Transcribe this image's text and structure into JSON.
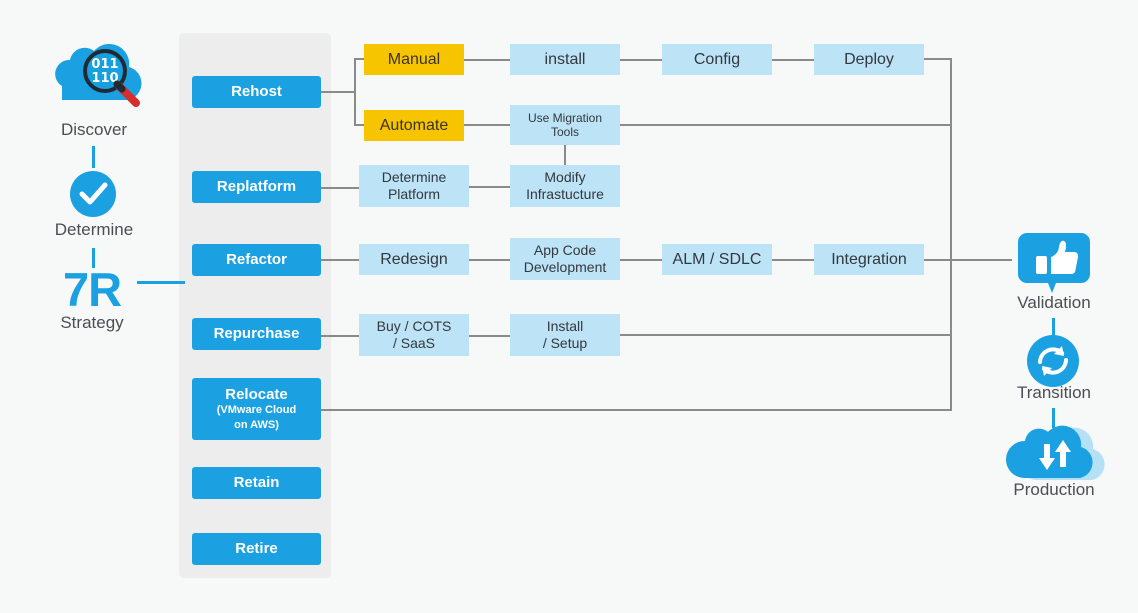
{
  "diagram": {
    "title": "7R Cloud Migration Strategy Flow",
    "colors": {
      "accent_blue": "#1ba1e2",
      "light_blue": "#bde3f7",
      "yellow": "#f6c500",
      "panel_gray": "#ededed",
      "line_gray": "#8a8a8a",
      "background": "#f7f8f8",
      "text_dark": "#4a4f54"
    }
  },
  "left_stages": [
    {
      "label": "Discover",
      "icon": "cloud-magnifier-binary-icon"
    },
    {
      "label": "Determine",
      "icon": "check-circle-icon"
    }
  ],
  "strategy_heading": {
    "title": "7R",
    "subtitle": "Strategy"
  },
  "strategies": [
    {
      "label": "Rehost",
      "sub": ""
    },
    {
      "label": "Replatform",
      "sub": ""
    },
    {
      "label": "Refactor",
      "sub": ""
    },
    {
      "label": "Repurchase",
      "sub": ""
    },
    {
      "label": "Relocate",
      "sub": "(VMware Cloud\non AWS)"
    },
    {
      "label": "Retain",
      "sub": ""
    },
    {
      "label": "Retire",
      "sub": ""
    }
  ],
  "rows": {
    "rehost_manual": [
      "Manual",
      "install",
      "Config",
      "Deploy"
    ],
    "rehost_automate": [
      "Automate",
      "Use Migration Tools"
    ],
    "replatform": [
      "Determine Platform",
      "Modify Infrastucture"
    ],
    "refactor": [
      "Redesign",
      "App Code Development",
      "ALM / SDLC",
      "Integration"
    ],
    "repurchase": [
      "Buy / COTS / SaaS",
      "Install / Setup"
    ]
  },
  "boxes": {
    "manual": "Manual",
    "install": "install",
    "config": "Config",
    "deploy": "Deploy",
    "automate": "Automate",
    "use_migration_tools_l1": "Use Migration",
    "use_migration_tools_l2": "Tools",
    "determine_platform_l1": "Determine",
    "determine_platform_l2": "Platform",
    "modify_infra_l1": "Modify",
    "modify_infra_l2": "Infrastucture",
    "redesign": "Redesign",
    "app_code_l1": "App Code",
    "app_code_l2": "Development",
    "alm_sdlc": "ALM / SDLC",
    "integration": "Integration",
    "buy_cots_l1": "Buy / COTS",
    "buy_cots_l2": "/ SaaS",
    "install_setup_l1": "Install",
    "install_setup_l2": "/ Setup",
    "relocate_main": "Relocate",
    "relocate_sub_l1": "(VMware Cloud",
    "relocate_sub_l2": "on AWS)",
    "rehost": "Rehost",
    "replatform": "Replatform",
    "refactor": "Refactor",
    "repurchase": "Repurchase",
    "retain": "Retain",
    "retire": "Retire"
  },
  "right_stages": [
    {
      "label": "Validation",
      "icon": "thumbs-up-bubble-icon"
    },
    {
      "label": "Transition",
      "icon": "sync-arrows-circle-icon"
    },
    {
      "label": "Production",
      "icon": "cloud-up-down-arrows-icon"
    }
  ],
  "discover_icon": {
    "binary_top": "011",
    "binary_bottom": "110"
  }
}
